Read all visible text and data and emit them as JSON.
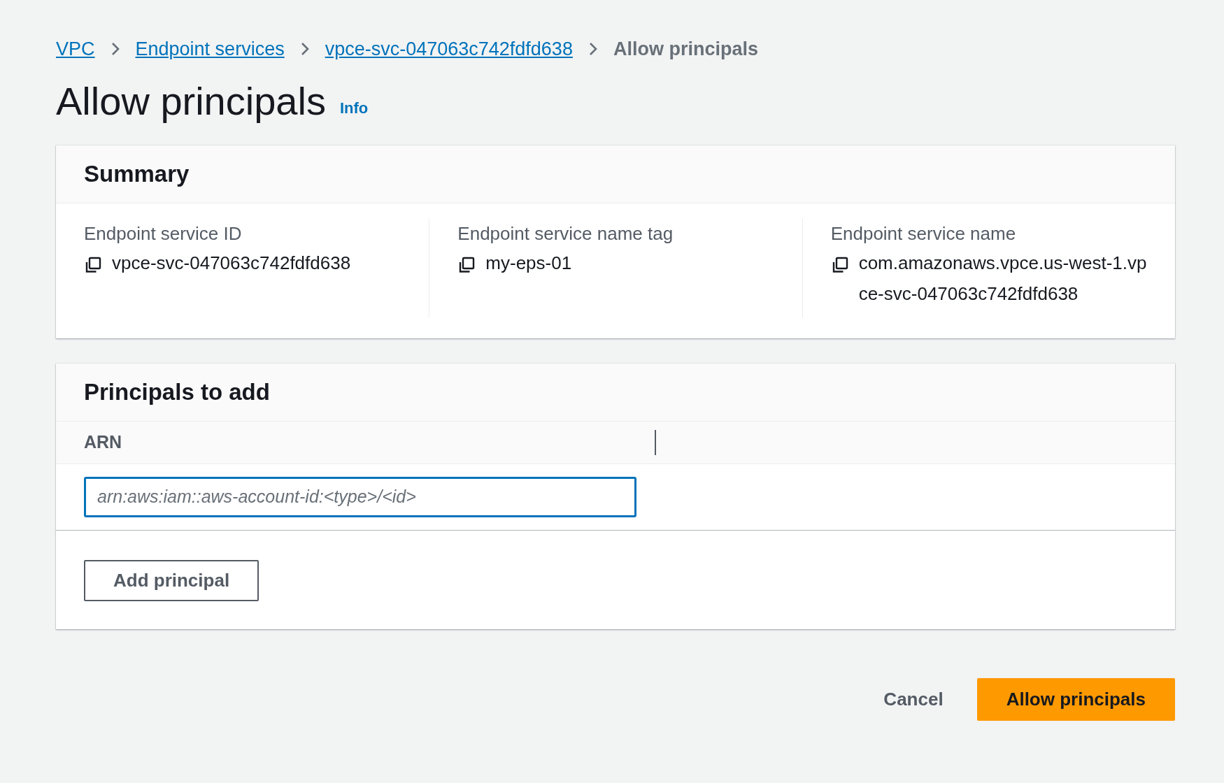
{
  "breadcrumbs": [
    {
      "label": "VPC",
      "kind": "link"
    },
    {
      "label": "Endpoint services",
      "kind": "link"
    },
    {
      "label": "vpce-svc-047063c742fdfd638",
      "kind": "link"
    },
    {
      "label": "Allow principals",
      "kind": "current"
    }
  ],
  "page_title": "Allow principals",
  "info_link": "Info",
  "summary": {
    "title": "Summary",
    "fields": [
      {
        "label": "Endpoint service ID",
        "value": "vpce-svc-047063c742fdfd638"
      },
      {
        "label": "Endpoint service name tag",
        "value": "my-eps-01"
      },
      {
        "label": "Endpoint service name",
        "value": "com.amazonaws.vpce.us-west-1.vpce-svc-047063c742fdfd638"
      }
    ]
  },
  "principals": {
    "title": "Principals to add",
    "columns": [
      "ARN"
    ],
    "input": {
      "placeholder": "arn:aws:iam::aws-account-id:<type>/<id>"
    },
    "add_button": "Add principal"
  },
  "footer": {
    "cancel": "Cancel",
    "submit": "Allow principals"
  }
}
